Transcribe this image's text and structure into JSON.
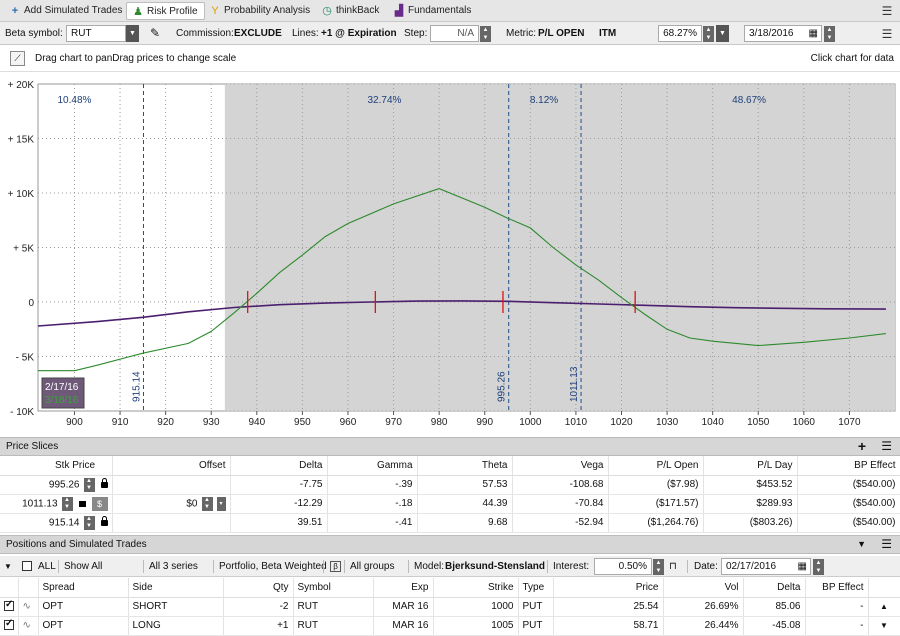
{
  "tabs": [
    {
      "label": "Add Simulated Trades",
      "icon": "plus-icon"
    },
    {
      "label": "Risk Profile",
      "icon": "risk-profile-icon"
    },
    {
      "label": "Probability Analysis",
      "icon": "probability-icon"
    },
    {
      "label": "thinkBack",
      "icon": "thinkback-icon"
    },
    {
      "label": "Fundamentals",
      "icon": "fundamentals-icon"
    }
  ],
  "toolbar": {
    "beta_label": "Beta symbol:",
    "beta_value": "RUT",
    "commission_label": "Commission:",
    "commission_value": "EXCLUDE",
    "lines_label": "Lines:",
    "lines_value": "+1 @ Expiration",
    "step_label": "Step:",
    "step_value": "N/A",
    "metric_label": "Metric:",
    "metric_value": "P/L OPEN",
    "itm_label": "ITM",
    "itm_value": "68.27%",
    "date_value": "3/18/2016"
  },
  "hint": {
    "left": "Drag chart to panDrag prices to change scale",
    "right": "Click chart for data"
  },
  "chart_data": {
    "type": "line",
    "x_ticks": [
      900,
      910,
      920,
      930,
      940,
      950,
      960,
      970,
      980,
      990,
      1000,
      1010,
      1020,
      1030,
      1040,
      1050,
      1060,
      1070
    ],
    "y_ticks": [
      20000,
      15000,
      10000,
      5000,
      0,
      -5000,
      -10000
    ],
    "y_tick_labels": [
      "+ 20K",
      "+ 15K",
      "+ 10K",
      "+ 5K",
      "0",
      "- 5K",
      "- 10K"
    ],
    "xlim": [
      892,
      1080
    ],
    "ylim": [
      -10000,
      20000
    ],
    "shaded_from": 933,
    "probabilities": [
      {
        "x": 900,
        "label": "10.48%"
      },
      {
        "x": 968,
        "label": "32.74%"
      },
      {
        "x": 1003,
        "label": "8.12%"
      },
      {
        "x": 1048,
        "label": "48.67%"
      }
    ],
    "markers": [
      {
        "x": 915.14,
        "label": "915.14"
      },
      {
        "x": 995.26,
        "label": "995.26"
      },
      {
        "x": 1011.13,
        "label": "1011.13"
      }
    ],
    "breakevens": [
      938,
      966,
      994,
      1023
    ],
    "series": [
      {
        "name": "2/17/16",
        "color": "#4b1f6e",
        "points": [
          [
            892,
            -2200
          ],
          [
            905,
            -1800
          ],
          [
            915,
            -1400
          ],
          [
            925,
            -900
          ],
          [
            935,
            -500
          ],
          [
            945,
            -250
          ],
          [
            955,
            -100
          ],
          [
            965,
            0
          ],
          [
            975,
            80
          ],
          [
            985,
            100
          ],
          [
            995,
            60
          ],
          [
            1005,
            -60
          ],
          [
            1015,
            -180
          ],
          [
            1025,
            -300
          ],
          [
            1035,
            -430
          ],
          [
            1045,
            -520
          ],
          [
            1055,
            -580
          ],
          [
            1065,
            -620
          ],
          [
            1078,
            -650
          ]
        ]
      },
      {
        "name": "3/18/16",
        "color": "#2d8a2d",
        "points": [
          [
            892,
            -6300
          ],
          [
            900,
            -6300
          ],
          [
            905,
            -5800
          ],
          [
            915,
            -4700
          ],
          [
            925,
            -3800
          ],
          [
            930,
            -2700
          ],
          [
            935,
            -1000
          ],
          [
            940,
            800
          ],
          [
            945,
            2700
          ],
          [
            950,
            4300
          ],
          [
            955,
            6000
          ],
          [
            960,
            7200
          ],
          [
            970,
            9000
          ],
          [
            980,
            10400
          ],
          [
            990,
            8700
          ],
          [
            995,
            7700
          ],
          [
            1000,
            6800
          ],
          [
            1005,
            5000
          ],
          [
            1010,
            3400
          ],
          [
            1015,
            2000
          ],
          [
            1020,
            400
          ],
          [
            1025,
            -1100
          ],
          [
            1030,
            -2500
          ],
          [
            1035,
            -3300
          ],
          [
            1040,
            -3600
          ],
          [
            1050,
            -4000
          ],
          [
            1060,
            -3700
          ],
          [
            1070,
            -3300
          ],
          [
            1078,
            -2900
          ]
        ]
      }
    ]
  },
  "price_slices": {
    "title": "Price Slices",
    "headers": [
      "Stk Price",
      "Offset",
      "Delta",
      "Gamma",
      "Theta",
      "Vega",
      "P/L Open",
      "P/L Day",
      "BP Effect"
    ],
    "rows": [
      {
        "price": "995.26",
        "offset": "",
        "delta": "-7.75",
        "gamma": "-.39",
        "theta": "57.53",
        "vega": "-108.68",
        "pl_open": "($7.98)",
        "pl_day": "$453.52",
        "bp": "($540.00)"
      },
      {
        "price": "1011.13",
        "offset": "$0",
        "delta": "-12.29",
        "gamma": "-.18",
        "theta": "44.39",
        "vega": "-70.84",
        "pl_open": "($171.57)",
        "pl_day": "$289.93",
        "bp": "($540.00)"
      },
      {
        "price": "915.14",
        "offset": "",
        "delta": "39.51",
        "gamma": "-.41",
        "theta": "9.68",
        "vega": "-52.94",
        "pl_open": "($1,264.76)",
        "pl_day": "($803.26)",
        "bp": "($540.00)"
      }
    ]
  },
  "positions": {
    "title": "Positions and Simulated Trades",
    "filter": {
      "all": "ALL",
      "show_all": "Show All",
      "series": "All 3 series",
      "portfolio": "Portfolio, Beta Weighted",
      "groups": "All groups",
      "model_label": "Model:",
      "model_value": "Bjerksund-Stensland",
      "interest_label": "Interest:",
      "interest_value": "0.50%",
      "date_label": "Date:",
      "date_value": "02/17/2016"
    },
    "headers": [
      "Spread",
      "Side",
      "Qty",
      "Symbol",
      "Exp",
      "Strike",
      "Type",
      "Price",
      "Vol",
      "Delta",
      "BP Effect"
    ],
    "rows": [
      {
        "spread": "OPT",
        "side": "SHORT",
        "qty": "-2",
        "symbol": "RUT",
        "exp": "MAR 16",
        "strike": "1000",
        "type": "PUT",
        "price": "25.54",
        "vol": "26.69%",
        "delta": "85.06",
        "bp": "-"
      },
      {
        "spread": "OPT",
        "side": "LONG",
        "qty": "+1",
        "symbol": "RUT",
        "exp": "MAR 16",
        "strike": "1005",
        "type": "PUT",
        "price": "58.71",
        "vol": "26.44%",
        "delta": "-45.08",
        "bp": "-"
      }
    ]
  }
}
